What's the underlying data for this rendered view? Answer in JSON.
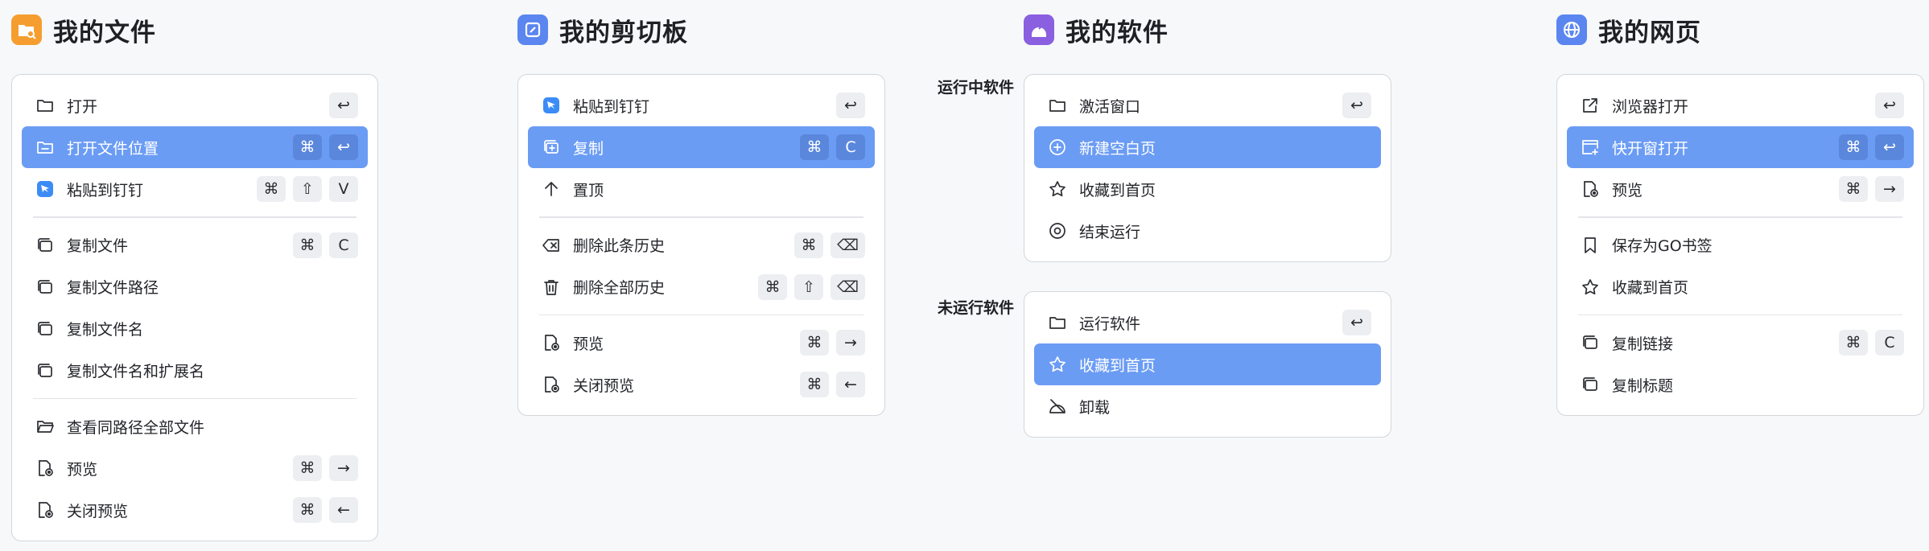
{
  "files": {
    "title": "我的文件",
    "logo_color": "#f59e2f",
    "items": [
      {
        "label": "打开",
        "icon": "folder-icon",
        "keys": [
          "↩"
        ]
      },
      {
        "label": "打开文件位置",
        "icon": "folder-location-icon",
        "keys": [
          "⌘",
          "↩"
        ],
        "active": true
      },
      {
        "label": "粘贴到钉钉",
        "icon": "dingtalk-icon",
        "keys": [
          "⌘",
          "⇧",
          "V"
        ]
      },
      {
        "label": "复制文件",
        "icon": "copy-icon",
        "keys": [
          "⌘",
          "C"
        ]
      },
      {
        "label": "复制文件路径",
        "icon": "copy-icon",
        "keys": []
      },
      {
        "label": "复制文件名",
        "icon": "copy-icon",
        "keys": []
      },
      {
        "label": "复制文件名和扩展名",
        "icon": "copy-icon",
        "keys": []
      },
      {
        "label": "查看同路径全部文件",
        "icon": "folder-open-icon",
        "keys": []
      },
      {
        "label": "预览",
        "icon": "file-preview-icon",
        "keys": [
          "⌘",
          "→"
        ]
      },
      {
        "label": "关闭预览",
        "icon": "file-preview-icon",
        "keys": [
          "⌘",
          "←"
        ]
      }
    ]
  },
  "clipboard": {
    "title": "我的剪切板",
    "logo_color": "#5b86f0",
    "items": [
      {
        "label": "粘贴到钉钉",
        "icon": "dingtalk-icon",
        "keys": [
          "↩"
        ]
      },
      {
        "label": "复制",
        "icon": "copy-plus-icon",
        "keys": [
          "⌘",
          "C"
        ],
        "active": true
      },
      {
        "label": "置顶",
        "icon": "arrow-up-icon",
        "keys": []
      },
      {
        "label": "删除此条历史",
        "icon": "delete-back-icon",
        "keys": [
          "⌘",
          "⌫"
        ]
      },
      {
        "label": "删除全部历史",
        "icon": "trash-icon",
        "keys": [
          "⌘",
          "⇧",
          "⌫"
        ]
      },
      {
        "label": "预览",
        "icon": "file-preview-icon",
        "keys": [
          "⌘",
          "→"
        ]
      },
      {
        "label": "关闭预览",
        "icon": "file-preview-icon",
        "keys": [
          "⌘",
          "←"
        ]
      }
    ]
  },
  "software": {
    "title": "我的软件",
    "logo_color": "#8a5fe0",
    "running_label": "运行中软件",
    "not_running_label": "未运行软件",
    "running_items": [
      {
        "label": "激活窗口",
        "icon": "folder-icon",
        "keys": [
          "↩"
        ]
      },
      {
        "label": "新建空白页",
        "icon": "plus-circle-icon",
        "keys": [],
        "active": true
      },
      {
        "label": "收藏到首页",
        "icon": "star-icon",
        "keys": []
      },
      {
        "label": "结束运行",
        "icon": "stop-circle-icon",
        "keys": []
      }
    ],
    "not_running_items": [
      {
        "label": "运行软件",
        "icon": "folder-icon",
        "keys": [
          "↩"
        ]
      },
      {
        "label": "收藏到首页",
        "icon": "star-icon",
        "keys": [],
        "active": true
      },
      {
        "label": "卸载",
        "icon": "uninstall-icon",
        "keys": []
      }
    ]
  },
  "web": {
    "title": "我的网页",
    "logo_color": "#5b86f0",
    "items": [
      {
        "label": "浏览器打开",
        "icon": "external-link-icon",
        "keys": [
          "↩"
        ]
      },
      {
        "label": "快开窗打开",
        "icon": "window-plus-icon",
        "keys": [
          "⌘",
          "↩"
        ],
        "active": true
      },
      {
        "label": "预览",
        "icon": "file-preview-icon",
        "keys": [
          "⌘",
          "→"
        ]
      },
      {
        "label": "保存为GO书签",
        "icon": "bookmark-icon",
        "keys": []
      },
      {
        "label": "收藏到首页",
        "icon": "star-icon",
        "keys": []
      },
      {
        "label": "复制链接",
        "icon": "copy-icon",
        "keys": [
          "⌘",
          "C"
        ]
      },
      {
        "label": "复制标题",
        "icon": "copy-icon",
        "keys": []
      }
    ]
  }
}
